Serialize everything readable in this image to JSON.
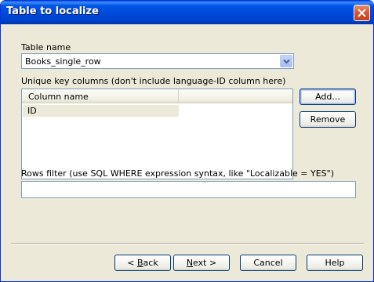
{
  "window": {
    "title": "Table to localize",
    "close_icon": "close-icon"
  },
  "table_name": {
    "label": "Table name",
    "selected_value": "Books_single_row"
  },
  "unique_key": {
    "label": "Unique key columns (don't include language-ID column here)",
    "column_header": "Column name",
    "rows": [
      "ID"
    ],
    "add_button": "Add...",
    "remove_button": "Remove"
  },
  "rows_filter": {
    "label": "Rows filter (use SQL WHERE expression syntax, like \"Localizable = YES\")",
    "value": ""
  },
  "footer": {
    "back_prefix": "< ",
    "back_accel": "B",
    "back_rest": "ack",
    "next_accel": "N",
    "next_rest": "ext >",
    "cancel_label": "Cancel",
    "help_label": "Help"
  },
  "colors": {
    "titlebar": "#0055e5",
    "dialog_bg": "#ece9d8",
    "border": "#7f9db9",
    "button_border": "#003c74"
  }
}
